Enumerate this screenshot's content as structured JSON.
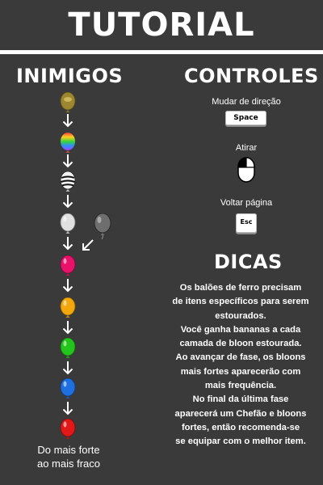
{
  "title": "TUTORIAL",
  "enemies": {
    "heading": "INIMIGOS",
    "order_caption_line1": "Do mais forte",
    "order_caption_line2": "ao mais fraco",
    "balloons": [
      {
        "name": "golden-bloon",
        "color": "#a08a3a"
      },
      {
        "name": "rainbow-bloon",
        "color": "#ff5a5a"
      },
      {
        "name": "zebra-bloon",
        "color": "#e8e8e8"
      },
      {
        "name": "white-bloon",
        "color": "#e0e0e0"
      },
      {
        "name": "pink-bloon",
        "color": "#e8126a"
      },
      {
        "name": "yellow-bloon",
        "color": "#f2a80c"
      },
      {
        "name": "green-bloon",
        "color": "#23c41b"
      },
      {
        "name": "blue-bloon",
        "color": "#1f6fe0"
      },
      {
        "name": "red-bloon",
        "color": "#e01818"
      }
    ],
    "side_balloon": {
      "name": "black-bloon",
      "color": "#6e6e6e"
    }
  },
  "controls": {
    "heading": "CONTROLES",
    "change_direction_label": "Mudar de direção",
    "space_key": "Space",
    "shoot_label": "Atirar",
    "mouse_icon": "mouse-left-click-icon",
    "back_page_label": "Voltar página",
    "esc_key": "Esc"
  },
  "tips": {
    "heading": "DICAS",
    "lines": [
      "Os balões de ferro precisam",
      "de itens específicos para serem",
      "estourados.",
      "Você ganha bananas a cada",
      "camada de bloon estourada.",
      "Ao avançar de fase, os bloons",
      "mais fortes aparecerão com",
      "mais frequência.",
      "No final da última fase",
      "aparecerá um Chefão e bloons",
      "fortes, então recomenda-se",
      "se equipar com o melhor item."
    ]
  }
}
